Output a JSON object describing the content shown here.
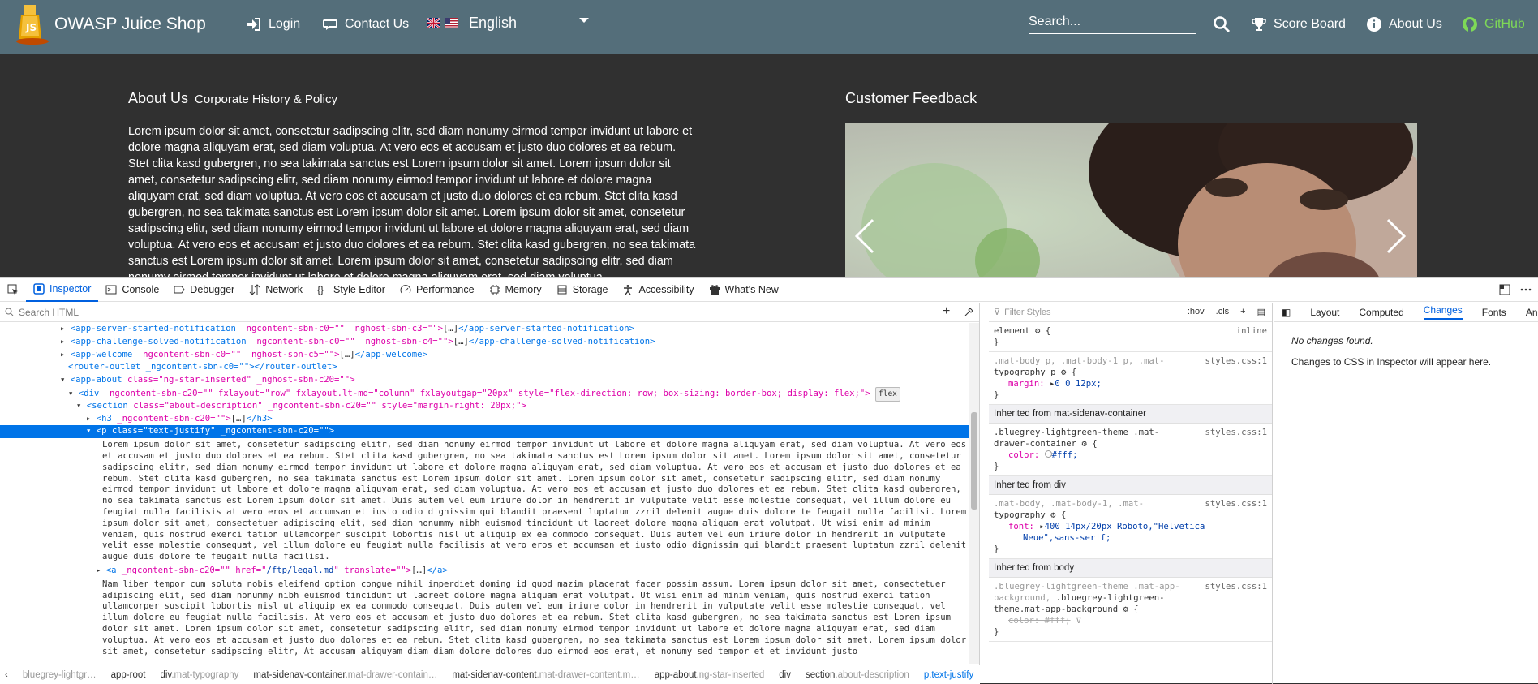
{
  "app": {
    "brand": "OWASP Juice Shop",
    "nav": {
      "login": "Login",
      "contact": "Contact Us",
      "language": "English",
      "search_placeholder": "Search...",
      "score_board": "Score Board",
      "about": "About Us",
      "github": "GitHub"
    }
  },
  "page": {
    "about_title": "About Us",
    "about_subtitle": "Corporate History & Policy",
    "about_text": "Lorem ipsum dolor sit amet, consetetur sadipscing elitr, sed diam nonumy eirmod tempor invidunt ut labore et dolore magna aliquyam erat, sed diam voluptua. At vero eos et accusam et justo duo dolores et ea rebum. Stet clita kasd gubergren, no sea takimata sanctus est Lorem ipsum dolor sit amet. Lorem ipsum dolor sit amet, consetetur sadipscing elitr, sed diam nonumy eirmod tempor invidunt ut labore et dolore magna aliquyam erat, sed diam voluptua. At vero eos et accusam et justo duo dolores et ea rebum. Stet clita kasd gubergren, no sea takimata sanctus est Lorem ipsum dolor sit amet. Lorem ipsum dolor sit amet, consetetur sadipscing elitr, sed diam nonumy eirmod tempor invidunt ut labore et dolore magna aliquyam erat, sed diam voluptua. At vero eos et accusam et justo duo dolores et ea rebum. Stet clita kasd gubergren, no sea takimata sanctus est Lorem ipsum dolor sit amet. Lorem ipsum dolor sit amet, consetetur sadipscing elitr, sed diam nonumy eirmod tempor invidunt ut labore et dolore magna aliquyam erat, sed diam voluptua.",
    "feedback_title": "Customer Feedback"
  },
  "devtools": {
    "tabs": [
      "Inspector",
      "Console",
      "Debugger",
      "Network",
      "Style Editor",
      "Performance",
      "Memory",
      "Storage",
      "Accessibility",
      "What's New"
    ],
    "search_placeholder": "Search HTML",
    "tree": {
      "r1_tag": "<app-server-started-notification",
      "r1_attr": "_ngcontent-sbn-c0=\"\" _nghost-sbn-c3=\"\">",
      "r1_close": "</app-server-started-notification>",
      "r2_tag": "<app-challenge-solved-notification",
      "r2_attr": "_ngcontent-sbn-c0=\"\" _nghost-sbn-c4=\"\">",
      "r2_close": "</app-challenge-solved-notification>",
      "r3_tag": "<app-welcome",
      "r3_attr": "_ngcontent-sbn-c0=\"\" _nghost-sbn-c5=\"\">",
      "r3_close": "</app-welcome>",
      "r4": "<router-outlet _ngcontent-sbn-c0=\"\"></router-outlet>",
      "r5_tag": "<app-about",
      "r5_attr": "class=\"ng-star-inserted\" _nghost-sbn-c20=\"\">",
      "r6_tag": "<div",
      "r6_attr": "_ngcontent-sbn-c20=\"\" fxlayout=\"row\" fxlayout.lt-md=\"column\" fxlayoutgap=\"20px\" style=\"flex-direction: row; box-sizing: border-box; display: flex;\">",
      "r6_badge": "flex",
      "r7_tag": "<section",
      "r7_attr": "class=\"about-description\" _ngcontent-sbn-c20=\"\" style=\"margin-right: 20px;\">",
      "r8_tag": "<h3",
      "r8_attr": "_ngcontent-sbn-c20=\"\">",
      "r8_close": "</h3>",
      "r9_tag": "<p",
      "r9_attr": "class=\"text-justify\" _ngcontent-sbn-c20=\"\">",
      "text1": "Lorem ipsum dolor sit amet, consetetur sadipscing elitr, sed diam nonumy eirmod tempor invidunt ut labore et dolore magna aliquyam erat, sed diam voluptua. At vero eos et accusam et justo duo dolores et ea rebum. Stet clita kasd gubergren, no sea takimata sanctus est Lorem ipsum dolor sit amet. Lorem ipsum dolor sit amet, consetetur sadipscing elitr, sed diam nonumy eirmod tempor invidunt ut labore et dolore magna aliquyam erat, sed diam voluptua. At vero eos et accusam et justo duo dolores et ea rebum. Stet clita kasd gubergren, no sea takimata sanctus est Lorem ipsum dolor sit amet. Lorem ipsum dolor sit amet, consetetur sadipscing elitr, sed diam nonumy eirmod tempor invidunt ut labore et dolore magna aliquyam erat, sed diam voluptua. At vero eos et accusam et justo duo dolores et ea rebum. Stet clita kasd gubergren, no sea takimata sanctus est Lorem ipsum dolor sit amet. Duis autem vel eum iriure dolor in hendrerit in vulputate velit esse molestie consequat, vel illum dolore eu feugiat nulla facilisis at vero eros et accumsan et iusto odio dignissim qui blandit praesent luptatum zzril delenit augue duis dolore te feugait nulla facilisi. Lorem ipsum dolor sit amet, consectetuer adipiscing elit, sed diam nonummy nibh euismod tincidunt ut laoreet dolore magna aliquam erat volutpat. Ut wisi enim ad minim veniam, quis nostrud exerci tation ullamcorper suscipit lobortis nisl ut aliquip ex ea commodo consequat. Duis autem vel eum iriure dolor in hendrerit in vulputate velit esse molestie consequat, vel illum dolore eu feugiat nulla facilisis at vero eros et accumsan et iusto odio dignissim qui blandit praesent luptatum zzril delenit augue duis dolore te feugait nulla facilisi.",
      "r10_tag": "<a",
      "r10_attr1": "_ngcontent-sbn-c20=\"\" href=\"",
      "r10_href": "/ftp/legal.md",
      "r10_attr2": "\" translate=\"\">",
      "r10_close": "</a>",
      "text2": "Nam liber tempor cum soluta nobis eleifend option congue nihil imperdiet doming id quod mazim placerat facer possim assum. Lorem ipsum dolor sit amet, consectetuer adipiscing elit, sed diam nonummy nibh euismod tincidunt ut laoreet dolore magna aliquam erat volutpat. Ut wisi enim ad minim veniam, quis nostrud exerci tation ullamcorper suscipit lobortis nisl ut aliquip ex ea commodo consequat. Duis autem vel eum iriure dolor in hendrerit in vulputate velit esse molestie consequat, vel illum dolore eu feugiat nulla facilisis. At vero eos et accusam et justo duo dolores et ea rebum. Stet clita kasd gubergren, no sea takimata sanctus est Lorem ipsum dolor sit amet. Lorem ipsum dolor sit amet, consetetur sadipscing elitr, sed diam nonumy eirmod tempor invidunt ut labore et dolore magna aliquyam erat, sed diam voluptua. At vero eos et accusam et justo duo dolores et ea rebum. Stet clita kasd gubergren, no sea takimata sanctus est Lorem ipsum dolor sit amet. Lorem ipsum dolor sit amet, consetetur sadipscing elitr, At accusam aliquyam diam diam dolore dolores duo eirmod eos erat, et nonumy sed tempor et et invidunt justo"
    },
    "breadcrumb": [
      "bluegrey-lightgr…",
      "app-root",
      "div",
      ".mat-typography",
      "mat-sidenav-container",
      ".mat-drawer-contain…",
      "mat-sidenav-content",
      ".mat-drawer-content.m…",
      "app-about",
      ".ng-star-inserted",
      "div",
      "section",
      ".about-description",
      "p",
      ".text-justify"
    ],
    "rules": {
      "filter_placeholder": "Filter Styles",
      "hov": ":hov",
      "cls": ".cls",
      "element_sel": "element",
      "element_src": "inline",
      "r1_sel_dim": ".mat-body p, .mat-body-1 p, .mat-",
      "r1_sel": "typography p",
      "r1_src": "styles.css:1",
      "r1_prop": "margin:",
      "r1_val": "0 0 12px;",
      "inh1": "Inherited from mat-sidenav-container",
      "r2_sel": ".bluegrey-lightgreen-theme .mat-",
      "r2_sel2": "drawer-container",
      "r2_src": "styles.css:1",
      "r2_prop": "color:",
      "r2_val": "#fff;",
      "inh2": "Inherited from div",
      "r3_sel_dim": ".mat-body, .mat-body-1, .mat-",
      "r3_sel": "typography",
      "r3_src": "styles.css:1",
      "r3_prop": "font:",
      "r3_val": "400 14px/20px Roboto,\"Helvetica",
      "r3_val2": "Neue\",sans-serif;",
      "inh3": "Inherited from body",
      "r4_sel_dim": ".bluegrey-lightgreen-theme .mat-app-",
      "r4_sel_dim2": "background,",
      "r4_sel": ".bluegrey-lightgreen-",
      "r4_sel2": "theme.mat-app-background",
      "r4_src": "styles.css:1",
      "r4_prop": "color: #fff;"
    },
    "right_tabs": [
      "Layout",
      "Computed",
      "Changes",
      "Fonts",
      "Anim"
    ],
    "no_changes": "No changes found.",
    "changes_hint": "Changes to CSS in Inspector will appear here."
  },
  "colors": {
    "toolbar": "#546e7a",
    "page_bg": "#303030",
    "github": "#7ed957",
    "selection": "#0074e8"
  }
}
